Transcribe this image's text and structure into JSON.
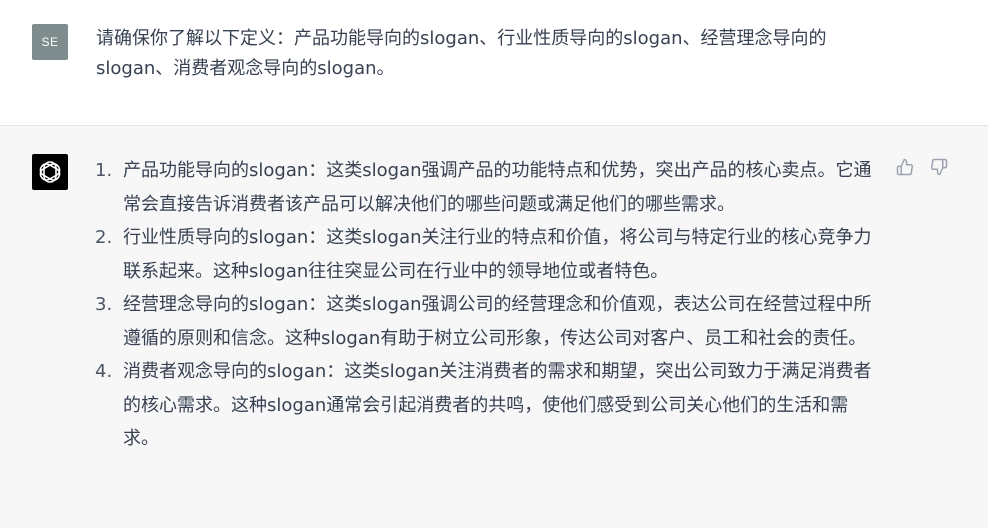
{
  "user": {
    "avatar_initials": "SE",
    "avatar_color": "#7f8c8d",
    "message": "请确保你了解以下定义：产品功能导向的slogan、行业性质导向的slogan、经营理念导向的slogan、消费者观念导向的slogan。"
  },
  "assistant": {
    "avatar_icon": "openai-logo-icon",
    "avatar_color": "#000000",
    "items": [
      {
        "number": "1.",
        "text": "产品功能导向的slogan：这类slogan强调产品的功能特点和优势，突出产品的核心卖点。它通常会直接告诉消费者该产品可以解决他们的哪些问题或满足他们的哪些需求。"
      },
      {
        "number": "2.",
        "text": "行业性质导向的slogan：这类slogan关注行业的特点和价值，将公司与特定行业的核心竞争力联系起来。这种slogan往往突显公司在行业中的领导地位或者特色。"
      },
      {
        "number": "3.",
        "text": "经营理念导向的slogan：这类slogan强调公司的经营理念和价值观，表达公司在经营过程中所遵循的原则和信念。这种slogan有助于树立公司形象，传达公司对客户、员工和社会的责任。"
      },
      {
        "number": "4.",
        "text": "消费者观念导向的slogan：这类slogan关注消费者的需求和期望，突出公司致力于满足消费者的核心需求。这种slogan通常会引起消费者的共鸣，使他们感受到公司关心他们的生活和需求。"
      }
    ],
    "feedback": {
      "thumbs_up_icon": "thumbs-up-icon",
      "thumbs_down_icon": "thumbs-down-icon",
      "icon_color": "#9ca3af"
    }
  }
}
